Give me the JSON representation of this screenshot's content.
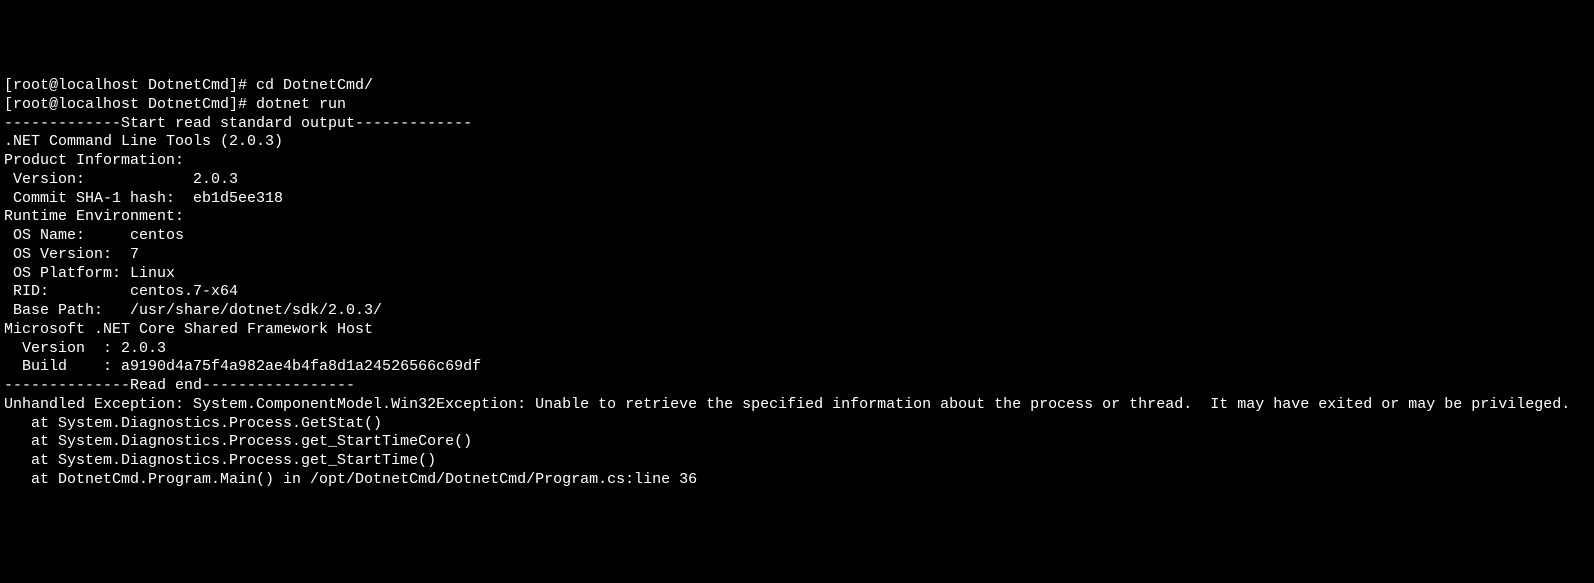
{
  "terminal": {
    "lines": {
      "l00": "[root@localhost DotnetCmd]# cd DotnetCmd/",
      "l01": "[root@localhost DotnetCmd]# dotnet run",
      "l02": "-------------Start read standard output-------------",
      "l03": ".NET Command Line Tools (2.0.3)",
      "l04": "",
      "l05": "Product Information:",
      "l06": " Version:            2.0.3",
      "l07": " Commit SHA-1 hash:  eb1d5ee318",
      "l08": "",
      "l09": "Runtime Environment:",
      "l10": " OS Name:     centos",
      "l11": " OS Version:  7",
      "l12": " OS Platform: Linux",
      "l13": " RID:         centos.7-x64",
      "l14": " Base Path:   /usr/share/dotnet/sdk/2.0.3/",
      "l15": "",
      "l16": "Microsoft .NET Core Shared Framework Host",
      "l17": "",
      "l18": "  Version  : 2.0.3",
      "l19": "  Build    : a9190d4a75f4a982ae4b4fa8d1a24526566c69df",
      "l20": "",
      "l21": "--------------Read end-----------------",
      "l22": "",
      "l23": "Unhandled Exception: System.ComponentModel.Win32Exception: Unable to retrieve the specified information about the process or thread.  It may have exited or may be privileged.",
      "l24": "   at System.Diagnostics.Process.GetStat()",
      "l25": "   at System.Diagnostics.Process.get_StartTimeCore()",
      "l26": "   at System.Diagnostics.Process.get_StartTime()",
      "l27": "   at DotnetCmd.Program.Main() in /opt/DotnetCmd/DotnetCmd/Program.cs:line 36"
    }
  }
}
